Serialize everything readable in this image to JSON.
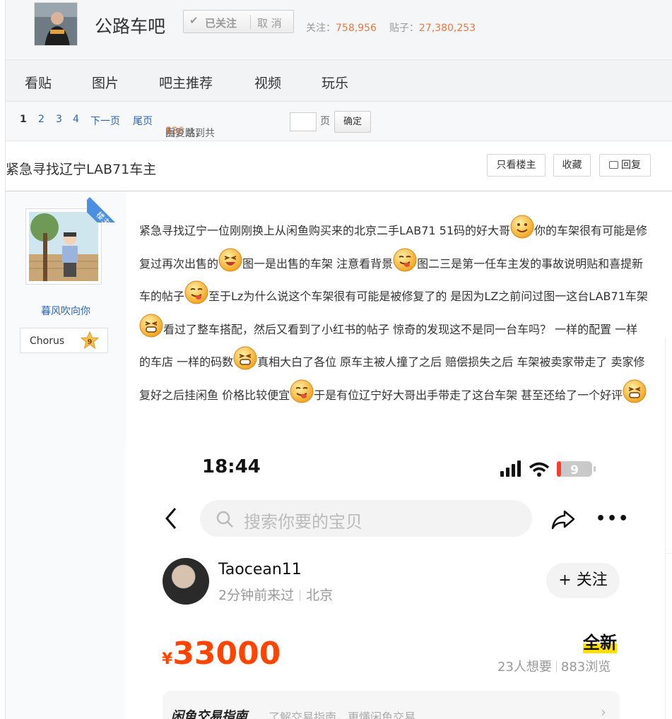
{
  "forum": {
    "name": "公路车吧",
    "followed_label": "已关注",
    "unfollow_label": "取 消",
    "follow_label": "关注：",
    "follow_count": "758,956",
    "posts_label": "贴子：",
    "posts_count": "27,380,253"
  },
  "tabs": [
    {
      "label": "看贴"
    },
    {
      "label": "图片"
    },
    {
      "label": "吧主推荐"
    },
    {
      "label": "视频"
    },
    {
      "label": "玩乐"
    }
  ],
  "pager": {
    "current": "1",
    "pages": [
      "2",
      "3",
      "4"
    ],
    "next": "下一页",
    "last": "尾页",
    "reply_count": "136",
    "reply_label": " 回复贴，共",
    "total_pages": "4",
    "pages_suffix": "页，跳到",
    "page_unit": "页",
    "confirm": "确定"
  },
  "thread": {
    "title": "紧急寻找辽宁LAB71车主",
    "only_op": "只看楼主",
    "favorite": "收藏",
    "reply": "回复"
  },
  "author": {
    "op_badge": "楼主",
    "name": "暮风吹向你",
    "badge_label": "Chorus",
    "level": "9"
  },
  "post": {
    "segments": [
      "紧急寻找辽宁一位刚刚换上从闲鱼购买来的北京二手LAB71 51码的好大哥",
      "你的车架很有可能是修复过再次出售的",
      "图一是出售的车架 注意看背景",
      "图二三是第一任车主发的事故说明贴和喜提新车的帖子",
      "至于Lz为什么说这个车架很有可能是被修复了的 是因为LZ之前问过图一这台LAB71车架",
      "看过了整车搭配，然后又看到了小红书的帖子 惊奇的发现这不是同一台车吗？ 一样的配置 一样的车店 一样的码数",
      "真相大白了各位 原车主被人撞了之后 赔偿损失之后 车架被卖家带走了 卖家修复好之后挂闲鱼 价格比较便宜",
      "于是有位辽宁好大哥出手带走了这台车架 甚至还给了一个好评",
      ""
    ],
    "emojis": [
      "smile-emoji",
      "laugh-emoji",
      "tongue-emoji",
      "tongue-emoji",
      "grin-emoji",
      "grin-emoji",
      "tongue-emoji",
      "grin-emoji"
    ]
  },
  "screenshot": {
    "time": "18:44",
    "battery": "9",
    "search_placeholder": "搜索你要的宝贝",
    "more": "•••",
    "seller_name": "Taocean11",
    "seller_seen": "2分钟前来过",
    "seller_city": "北京",
    "follow": "+ 关注",
    "currency": "¥",
    "price": "33000",
    "condition": "全新",
    "wants": "23人想要",
    "views": "883浏览",
    "guide_title": "闲鱼交易指南",
    "guide_sub": "了解交易指南，更懂闲鱼交易",
    "guide_chevron": "›"
  }
}
